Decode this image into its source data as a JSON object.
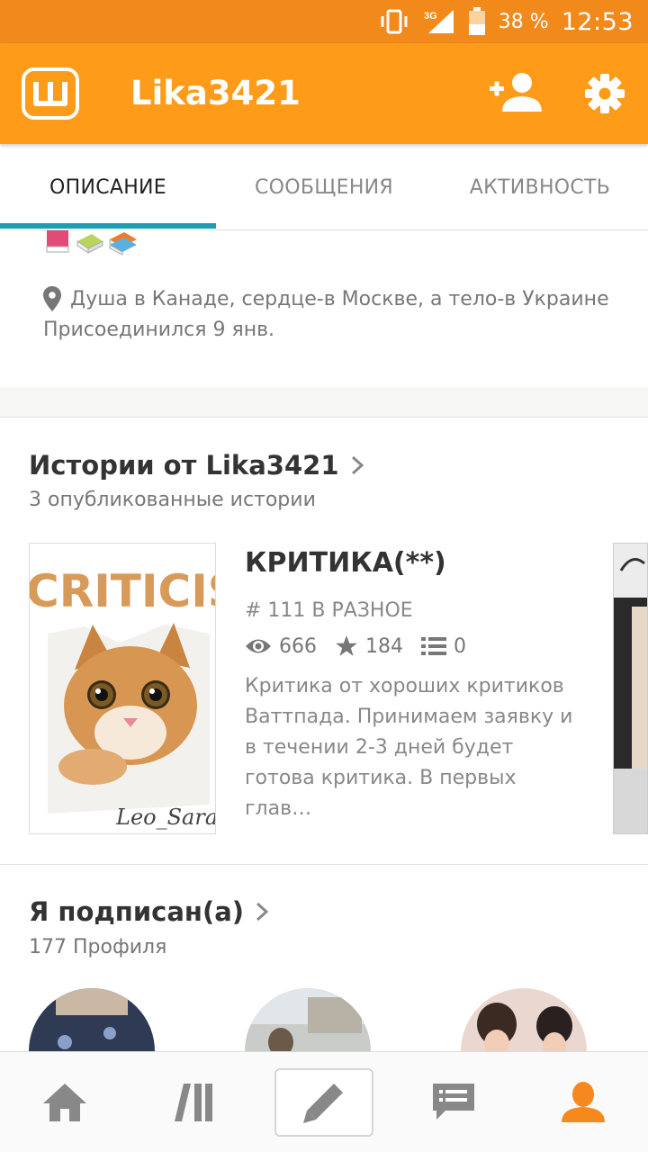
{
  "status_bar": {
    "battery": "38 %",
    "time": "12:53",
    "network": "3G"
  },
  "app_bar": {
    "title": "Lika3421"
  },
  "tabs": [
    {
      "label": "ОПИСАНИЕ",
      "active": true
    },
    {
      "label": "СООБЩЕНИЯ",
      "active": false
    },
    {
      "label": "АКТИВНОСТЬ",
      "active": false
    }
  ],
  "profile": {
    "location": "Душа в Канаде, сердце-в Москве, а тело-в Украине",
    "joined": "Присоединился 9 янв."
  },
  "stories_section": {
    "title": "Истории от Lika3421",
    "subtitle": "3 опубликованные истории",
    "story": {
      "cover_text": "CRITICISM",
      "cover_signature": "Leo_Sara",
      "title": "КРИТИКА(**)",
      "rank": "# 111 В РАЗНОЕ",
      "reads": "666",
      "votes": "184",
      "parts": "0",
      "description": "Критика от хороших критиков Ваттпада. Принимаем заявку и в течении 2-3 дней будет готова критика. В первых глав…"
    }
  },
  "following_section": {
    "title": "Я подписан(а)",
    "subtitle": "177 Профиля"
  },
  "colors": {
    "accent": "#fe9b19",
    "tab_indicator": "#1a9fb3",
    "nav_active": "#f5891e"
  },
  "bottom_nav": [
    "home-icon",
    "library-icon",
    "write-icon",
    "messages-icon",
    "profile-icon"
  ]
}
